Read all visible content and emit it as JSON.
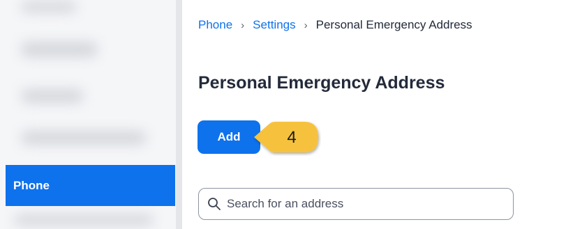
{
  "breadcrumb": {
    "items": [
      "Phone",
      "Settings"
    ],
    "separator": "›",
    "current": "Personal Emergency Address"
  },
  "page": {
    "title": "Personal Emergency Address"
  },
  "toolbar": {
    "add_label": "Add"
  },
  "callout": {
    "step_number": "4",
    "color": "#f6c23e"
  },
  "sidebar": {
    "active_item_label": "Phone",
    "accent": "#0e72ed"
  },
  "search": {
    "placeholder": "Search for an address",
    "icon": "search-icon"
  }
}
